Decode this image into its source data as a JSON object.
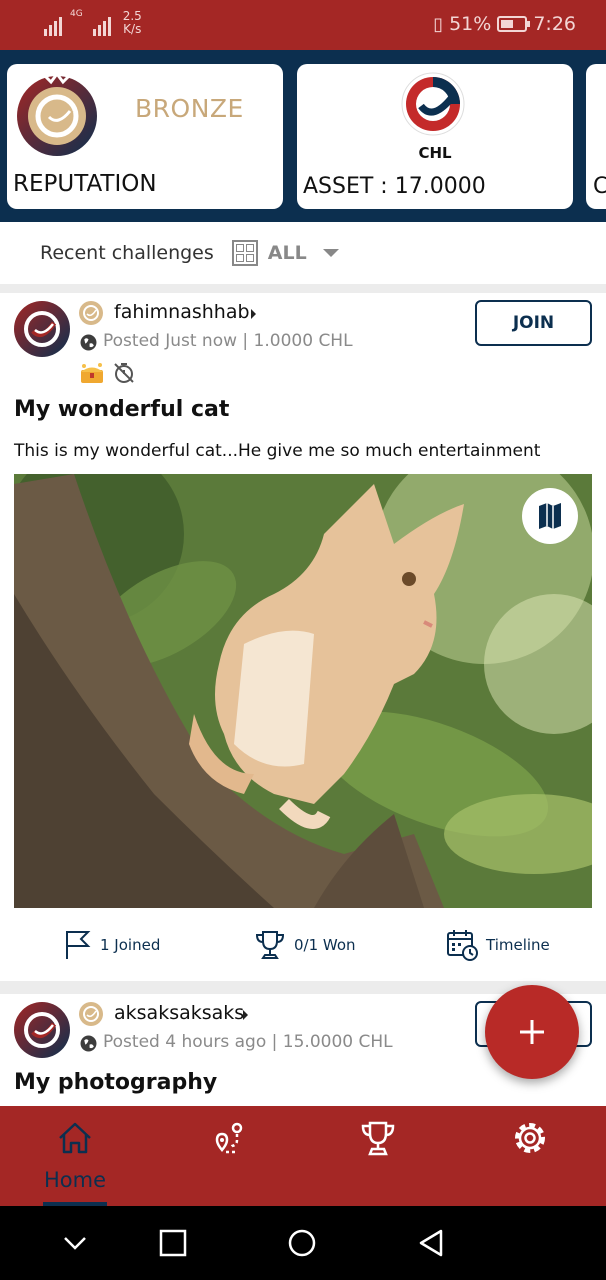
{
  "status_bar": {
    "network": "4G",
    "speed_value": "2.5",
    "speed_unit": "K/s",
    "battery_pct": "51%",
    "battery_level": 0.51,
    "time": "7:26"
  },
  "header": {
    "reputation": {
      "tier": "BRONZE",
      "label": "REPUTATION"
    },
    "asset": {
      "currency": "CHL",
      "label": "ASSET : 17.0000"
    },
    "next_card_letter": "C"
  },
  "filter": {
    "label": "Recent challenges",
    "value": "ALL"
  },
  "posts": [
    {
      "username": "fahimnashhab",
      "meta": "Posted Just now | 1.0000 CHL",
      "join_label": "JOIN",
      "title": "My wonderful cat",
      "description": "This is my wonderful cat...He give me so much entertainment",
      "stats": {
        "joined": "1 Joined",
        "won": "0/1 Won",
        "timeline": "Timeline"
      }
    },
    {
      "username": "aksaksaksaks",
      "meta": "Posted 4 hours ago | 15.0000 CHL",
      "title": "My photography"
    }
  ],
  "fab": {
    "icon": "plus-icon"
  },
  "nav": {
    "home_label": "Home",
    "items": [
      "home-icon",
      "map-route-icon",
      "trophy-icon",
      "settings-gear-icon"
    ]
  },
  "colors": {
    "primary_red": "#a42725",
    "navy": "#0c2f4f",
    "bronze": "#c8a87a",
    "fab_red": "#b82a27"
  }
}
